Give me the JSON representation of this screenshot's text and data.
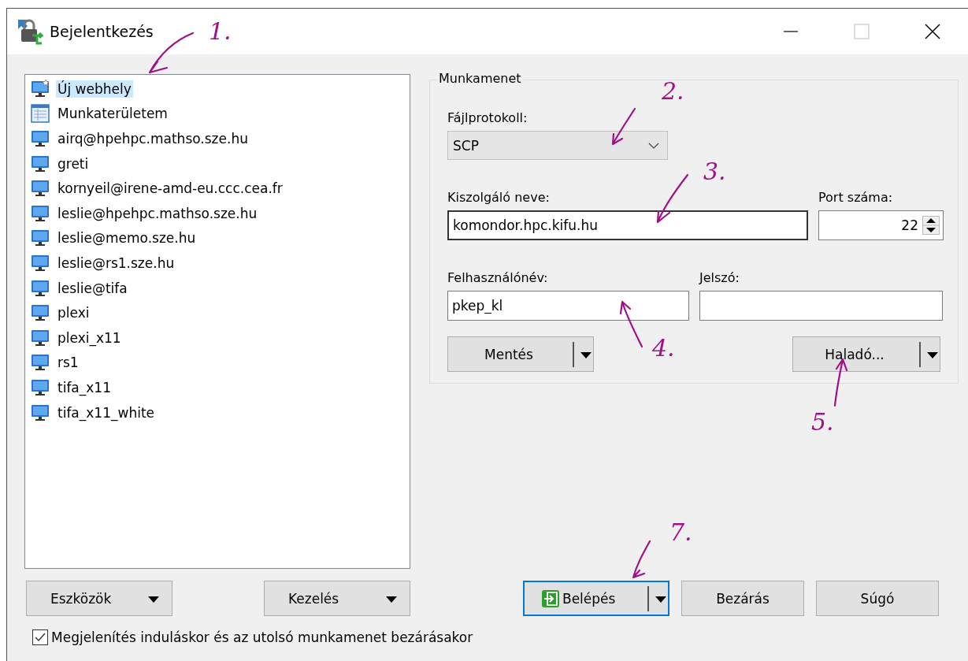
{
  "window": {
    "title": "Bejelentkezés",
    "maximize_disabled": true
  },
  "sites": [
    {
      "label": "Új webhely",
      "kind": "new",
      "selected": true
    },
    {
      "label": "Munkaterületem",
      "kind": "workspace",
      "selected": false
    },
    {
      "label": "airq@hpehpc.mathso.sze.hu",
      "kind": "site",
      "selected": false
    },
    {
      "label": "greti",
      "kind": "site",
      "selected": false
    },
    {
      "label": "kornyeil@irene-amd-eu.ccc.cea.fr",
      "kind": "site",
      "selected": false
    },
    {
      "label": "leslie@hpehpc.mathso.sze.hu",
      "kind": "site",
      "selected": false
    },
    {
      "label": "leslie@memo.sze.hu",
      "kind": "site",
      "selected": false
    },
    {
      "label": "leslie@rs1.sze.hu",
      "kind": "site",
      "selected": false
    },
    {
      "label": "leslie@tifa",
      "kind": "site",
      "selected": false
    },
    {
      "label": "plexi",
      "kind": "site",
      "selected": false
    },
    {
      "label": "plexi_x11",
      "kind": "site",
      "selected": false
    },
    {
      "label": "rs1",
      "kind": "site",
      "selected": false
    },
    {
      "label": "tifa_x11",
      "kind": "site",
      "selected": false
    },
    {
      "label": "tifa_x11_white",
      "kind": "site",
      "selected": false
    }
  ],
  "session": {
    "title": "Munkamenet",
    "protocol": {
      "label": "Fájlprotokoll:",
      "value": "SCP"
    },
    "host": {
      "label": "Kiszolgáló neve:",
      "value": "komondor.hpc.kifu.hu"
    },
    "port": {
      "label": "Port száma:",
      "value": "22"
    },
    "username": {
      "label": "Felhasználónév:",
      "value": "pkep_kl"
    },
    "password": {
      "label": "Jelszó:"
    },
    "save_button": "Mentés",
    "advanced_button": "Haladó..."
  },
  "left_buttons": [
    "Eszközök",
    "Kezelés"
  ],
  "bottom_buttons": [
    {
      "label": "Belépés",
      "kind": "login",
      "focused": true
    },
    {
      "label": "Bezárás",
      "kind": "plain",
      "focused": false
    },
    {
      "label": "Súgó",
      "kind": "plain",
      "focused": false
    }
  ],
  "show_on_startup": {
    "label": "Megjelenítés induláskor és az utolsó munkamenet bezárásakor",
    "checked": true
  },
  "annotations": [
    {
      "label": "1."
    },
    {
      "label": "2."
    },
    {
      "label": "3."
    },
    {
      "label": "4."
    },
    {
      "label": "5."
    },
    {
      "label": "7."
    }
  ]
}
